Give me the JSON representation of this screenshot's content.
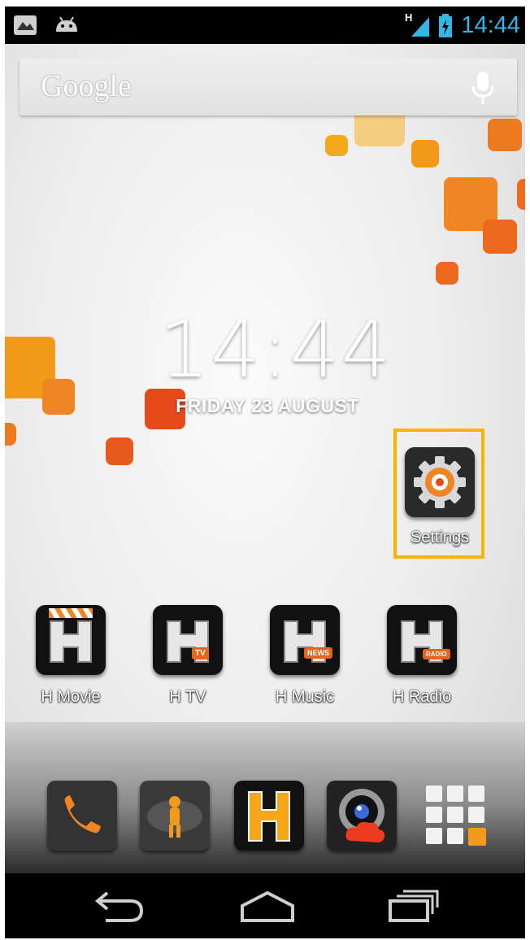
{
  "status_bar": {
    "time": "14:44",
    "network": "H",
    "icons": [
      "notification-picture-icon",
      "android-icon",
      "signal-icon",
      "battery-charging-icon"
    ],
    "accent_color": "#33b5e5"
  },
  "search_bar": {
    "brand": "Google",
    "mic_icon": "mic-icon"
  },
  "clock_widget": {
    "time": "14:44",
    "date": "FRIDAY 23 AUGUST"
  },
  "shortcut": {
    "label": "Settings",
    "icon": "settings-gear-icon",
    "highlight_color": "#f7b500"
  },
  "apps": [
    {
      "label": "H Movie",
      "icon": "h-movie-icon",
      "badge": ""
    },
    {
      "label": "H TV",
      "icon": "h-tv-icon",
      "badge": "TV"
    },
    {
      "label": "H Music",
      "icon": "h-music-icon",
      "badge": "NEWS"
    },
    {
      "label": "H Radio",
      "icon": "h-radio-icon",
      "badge": "RADIO"
    }
  ],
  "dock": [
    "phone-icon",
    "explorer-icon",
    "h-app-icon",
    "camera-cloud-icon",
    "app-drawer-icon"
  ],
  "nav_bar": [
    "back-icon",
    "home-icon",
    "recent-apps-icon"
  ]
}
